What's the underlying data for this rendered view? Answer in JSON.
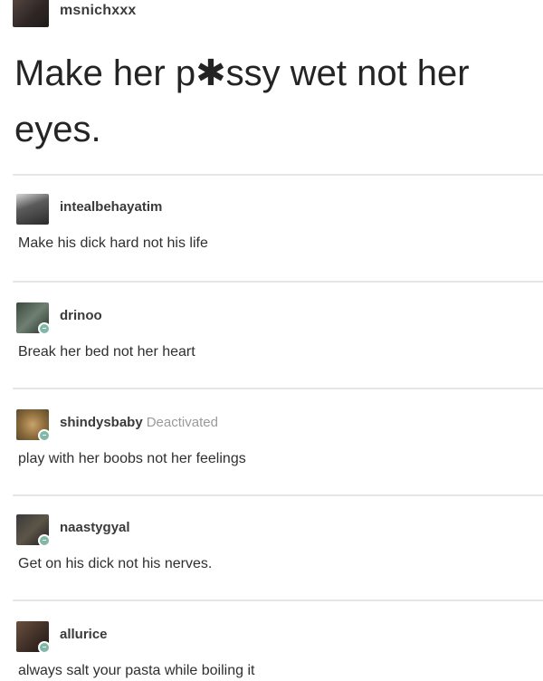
{
  "op": {
    "username": "msnichxxx",
    "text": "Make her p✱ssy wet not her eyes."
  },
  "entries": [
    {
      "username": "intealbehayatim",
      "status": "",
      "text": "Make his dick hard not his life"
    },
    {
      "username": "drinoo",
      "status": "",
      "text": "Break her bed not her heart"
    },
    {
      "username": "shindysbaby",
      "status": "Deactivated",
      "text": "play with her boobs not her feelings"
    },
    {
      "username": "naastygyal",
      "status": "",
      "text": "Get on his dick not his nerves."
    },
    {
      "username": "allurice",
      "status": "",
      "text": "always salt your pasta while boiling it"
    }
  ]
}
